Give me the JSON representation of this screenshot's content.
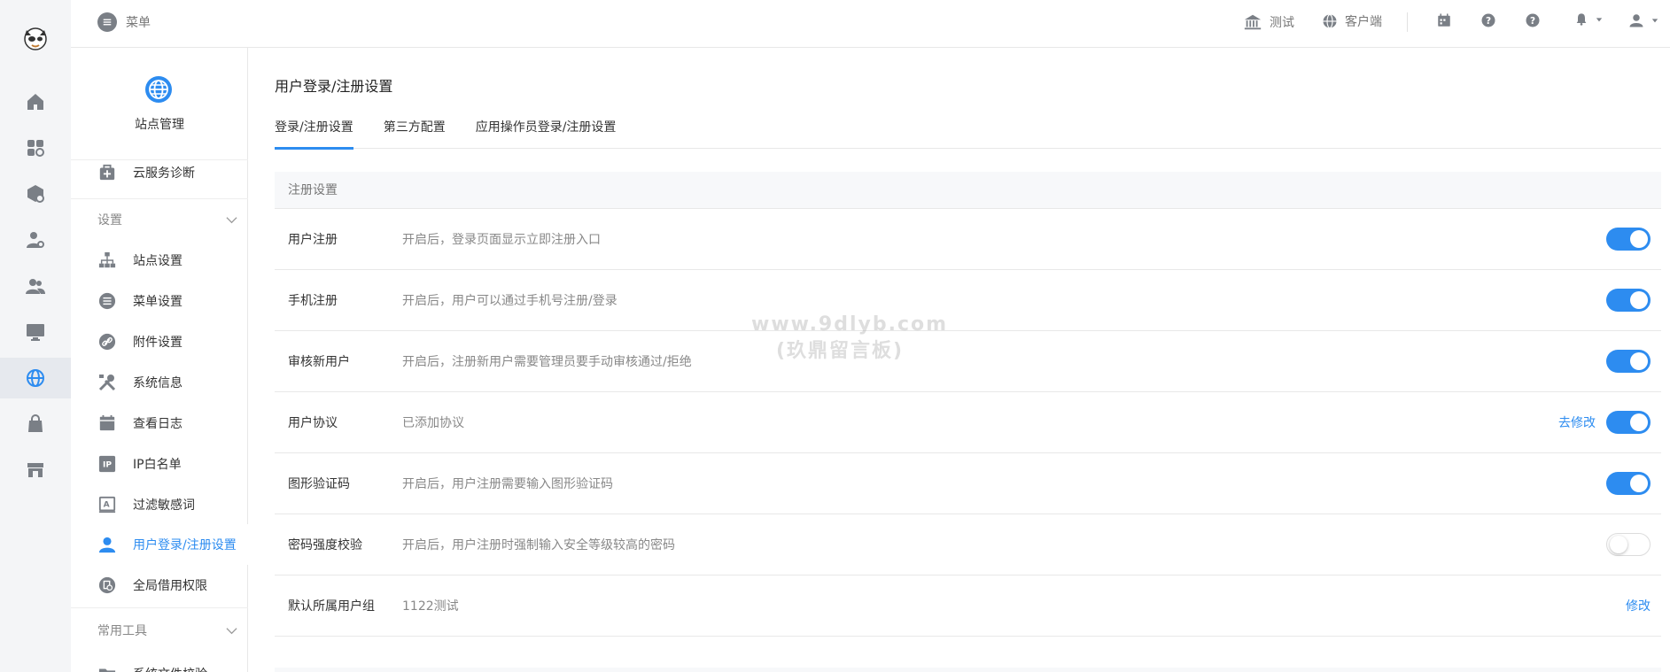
{
  "topbar": {
    "menu_label": "菜单",
    "items": [
      {
        "label": "测试",
        "icon": "bank-icon"
      },
      {
        "label": "客户端",
        "icon": "globe-icon"
      }
    ]
  },
  "rail": {
    "items": [
      "home-icon",
      "apps-icon",
      "box-settings-icon",
      "user-settings-icon",
      "users-icon",
      "monitor-icon",
      "globe-icon",
      "bag-icon",
      "store-icon"
    ],
    "active_index": 6
  },
  "sidebar": {
    "title": "站点管理",
    "top_item": "云服务诊断",
    "group_settings": "设置",
    "items": [
      {
        "label": "站点设置",
        "icon": "sitemap-icon"
      },
      {
        "label": "菜单设置",
        "icon": "list-icon"
      },
      {
        "label": "附件设置",
        "icon": "link-icon"
      },
      {
        "label": "系统信息",
        "icon": "tools-icon"
      },
      {
        "label": "查看日志",
        "icon": "log-icon"
      },
      {
        "label": "IP白名单",
        "icon": "ip-icon"
      },
      {
        "label": "过滤敏感词",
        "icon": "filter-icon"
      },
      {
        "label": "用户登录/注册设置",
        "icon": "user-icon"
      },
      {
        "label": "全局借用权限",
        "icon": "permission-icon"
      }
    ],
    "active_index": 7,
    "group_tools": "常用工具",
    "bottom_item": "系统文件校验"
  },
  "page": {
    "title": "用户登录/注册设置",
    "tabs": [
      "登录/注册设置",
      "第三方配置",
      "应用操作员登录/注册设置"
    ],
    "active_tab": 0
  },
  "section": {
    "title": "注册设置",
    "rows": [
      {
        "label": "用户注册",
        "desc": "开启后，登录页面显示立即注册入口",
        "switch": "on"
      },
      {
        "label": "手机注册",
        "desc": "开启后，用户可以通过手机号注册/登录",
        "switch": "on"
      },
      {
        "label": "审核新用户",
        "desc": "开启后，注册新用户需要管理员要手动审核通过/拒绝",
        "switch": "on"
      },
      {
        "label": "用户协议",
        "desc": "已添加协议",
        "link": "去修改",
        "switch": "on"
      },
      {
        "label": "图形验证码",
        "desc": "开启后，用户注册需要输入图形验证码",
        "switch": "on"
      },
      {
        "label": "密码强度校验",
        "desc": "开启后，用户注册时强制输入安全等级较高的密码",
        "switch": "off"
      },
      {
        "label": "默认所属用户组",
        "desc": "1122测试",
        "link": "修改"
      }
    ]
  },
  "watermark": {
    "line1": "www.9dlyb.com",
    "line2": "(玖鼎留言板)"
  },
  "colors": {
    "accent": "#2d8cf0",
    "rail_bg": "#f4f5f7",
    "section_bg": "#f7f8fa"
  }
}
